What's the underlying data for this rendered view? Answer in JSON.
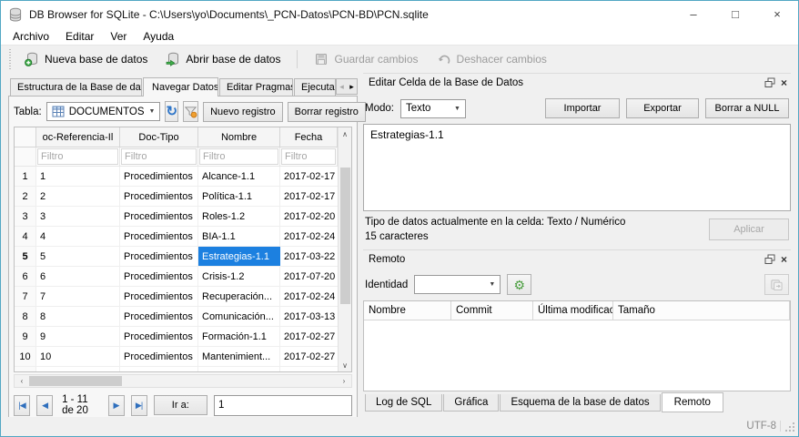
{
  "window": {
    "title": "DB Browser for SQLite - C:\\Users\\yo\\Documents\\_PCN-Datos\\PCN-BD\\PCN.sqlite",
    "minimize": "–",
    "maximize": "□",
    "close": "×"
  },
  "menu": {
    "items": [
      "Archivo",
      "Editar",
      "Ver",
      "Ayuda"
    ]
  },
  "toolbar": {
    "new_db": "Nueva base de datos",
    "open_db": "Abrir base de datos",
    "save": "Guardar cambios",
    "undo": "Deshacer cambios"
  },
  "browse": {
    "tabs": [
      "Estructura de la Base de datos",
      "Navegar Datos",
      "Editar Pragmas",
      "Ejecuta"
    ],
    "active_tab": "Navegar Datos",
    "table_label": "Tabla:",
    "table_value": "DOCUMENTOS",
    "new_record": "Nuevo registro",
    "delete_record": "Borrar registro",
    "grid": {
      "columns": [
        "oc-Referencia-Il",
        "Doc-Tipo",
        "Nombre",
        "Fecha"
      ],
      "filter_placeholder": "Filtro",
      "selected_row": 5,
      "selected_col": 2,
      "rows": [
        [
          "1",
          "Procedimientos",
          "Alcance-1.1",
          "2017-02-17"
        ],
        [
          "2",
          "Procedimientos",
          "Política-1.1",
          "2017-02-17"
        ],
        [
          "3",
          "Procedimientos",
          "Roles-1.2",
          "2017-02-20"
        ],
        [
          "4",
          "Procedimientos",
          "BIA-1.1",
          "2017-02-24"
        ],
        [
          "5",
          "Procedimientos",
          "Estrategias-1.1",
          "2017-03-22"
        ],
        [
          "6",
          "Procedimientos",
          "Crisis-1.2",
          "2017-07-20"
        ],
        [
          "7",
          "Procedimientos",
          "Recuperación...",
          "2017-02-24"
        ],
        [
          "8",
          "Procedimientos",
          "Comunicación...",
          "2017-03-13"
        ],
        [
          "9",
          "Procedimientos",
          "Formación-1.1",
          "2017-02-27"
        ],
        [
          "10",
          "Procedimientos",
          "Mantenimient...",
          "2017-02-27"
        ]
      ]
    },
    "pagination": {
      "first": "|◀",
      "prev": "◀",
      "range": "1 - 11 de 20",
      "next": "▶",
      "last": "▶|",
      "goto_label": "Ir a:",
      "goto_value": "1"
    }
  },
  "edit_cell": {
    "title": "Editar Celda de la Base de Datos",
    "mode_label": "Modo:",
    "mode_value": "Texto",
    "import": "Importar",
    "export": "Exportar",
    "set_null": "Borrar a NULL",
    "content": "Estrategias-1.1",
    "type_info": "Tipo de datos actualmente en la celda: Texto / Numérico",
    "char_count": "15 caracteres",
    "apply": "Aplicar"
  },
  "remote": {
    "title": "Remoto",
    "identity_label": "Identidad",
    "columns": [
      "Nombre",
      "Commit",
      "Última modificac",
      "Tamaño"
    ]
  },
  "bottom_tabs": {
    "items": [
      "Log de SQL",
      "Gráfica",
      "Esquema de la base de datos",
      "Remoto"
    ],
    "active": "Remoto"
  },
  "status": {
    "encoding": "UTF-8"
  },
  "icons": {
    "combo_arrow": "▼",
    "refresh": "↻",
    "gear": "⚙",
    "scroll_up": "∧",
    "scroll_down": "∨",
    "scroll_left": "‹",
    "scroll_right": "›",
    "tab_scroll_left": "◂",
    "tab_scroll_right": "▸"
  },
  "colors": {
    "selection": "#1c80e0",
    "accent_green": "#3fae49",
    "accent_blue": "#2e75c8",
    "window_border": "#52a7c4"
  }
}
